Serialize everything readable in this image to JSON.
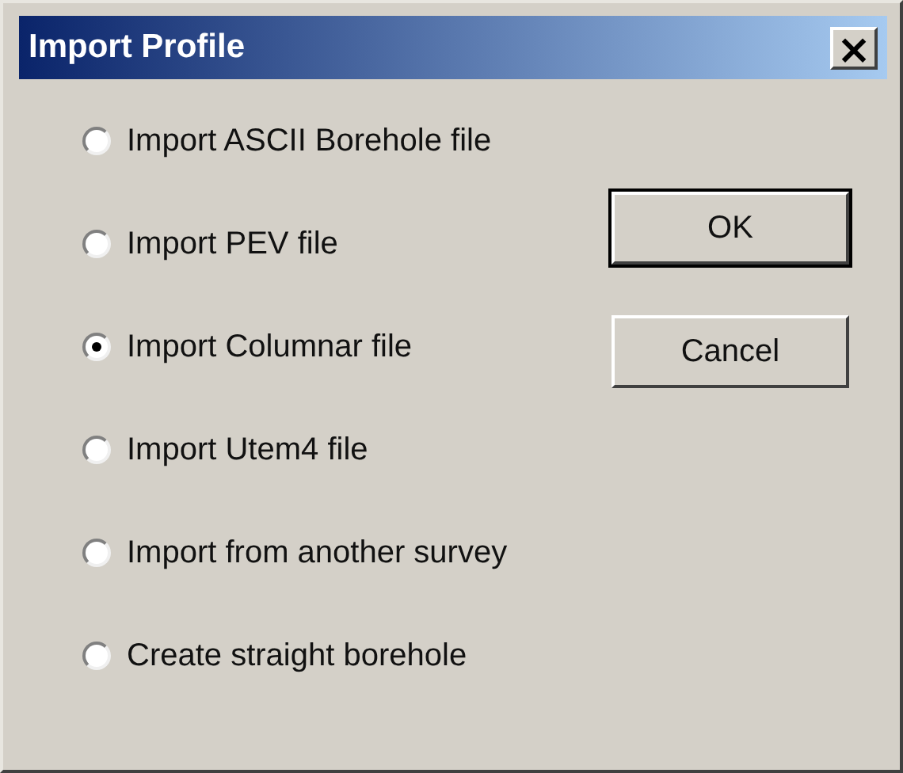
{
  "window": {
    "title": "Import Profile",
    "close": "×"
  },
  "options": [
    {
      "label": "Import ASCII Borehole file",
      "selected": false
    },
    {
      "label": "Import PEV file",
      "selected": false
    },
    {
      "label": "Import Columnar file",
      "selected": true
    },
    {
      "label": "Import Utem4 file",
      "selected": false
    },
    {
      "label": "Import from another survey",
      "selected": false
    },
    {
      "label": "Create straight borehole",
      "selected": false
    }
  ],
  "buttons": [
    {
      "label": "OK",
      "default": true
    },
    {
      "label": "Cancel",
      "default": false
    }
  ]
}
